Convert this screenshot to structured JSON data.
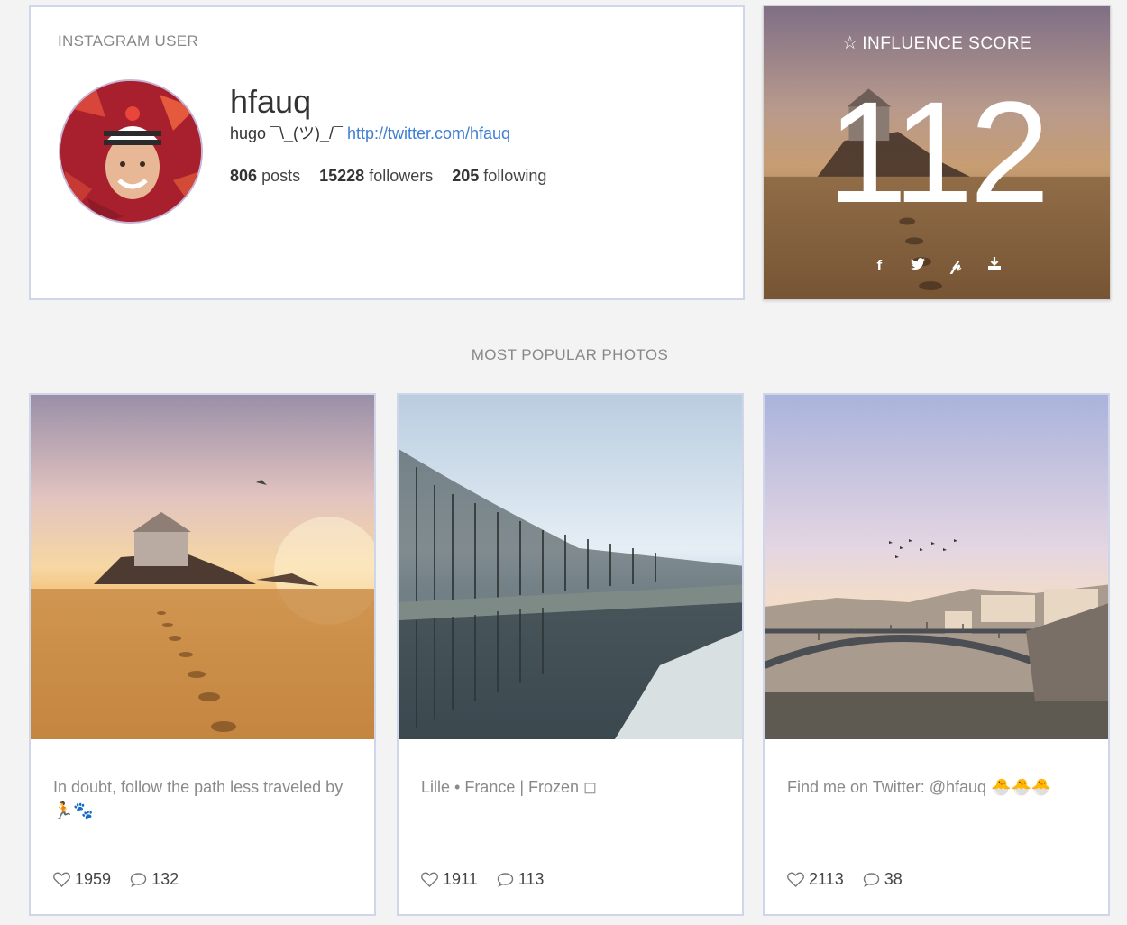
{
  "profile": {
    "heading": "INSTAGRAM USER",
    "username": "hfauq",
    "bio_text": "hugo ¯\\_(ツ)_/¯ ",
    "bio_link": "http://twitter.com/hfauq",
    "posts_count": "806",
    "posts_label": "posts",
    "followers_count": "15228",
    "followers_label": "followers",
    "following_count": "205",
    "following_label": "following"
  },
  "influence": {
    "title": "INFLUENCE SCORE",
    "score": "112",
    "share_icons": [
      "facebook-icon",
      "twitter-icon",
      "pinterest-icon",
      "download-icon"
    ]
  },
  "section": {
    "heading": "MOST POPULAR PHOTOS"
  },
  "photos": [
    {
      "caption": "In doubt, follow the path less traveled by 🏃🐾",
      "likes": "1959",
      "comments": "132"
    },
    {
      "caption": "Lille • France | Frozen ◻",
      "likes": "1911",
      "comments": "113"
    },
    {
      "caption": "Find me on Twitter: @hfauq 🐣🐣🐣",
      "likes": "2113",
      "comments": "38"
    }
  ],
  "colors": {
    "accent_link": "#3f7fd3",
    "card_border": "#cfd6ea",
    "background": "#f3f3f4"
  }
}
